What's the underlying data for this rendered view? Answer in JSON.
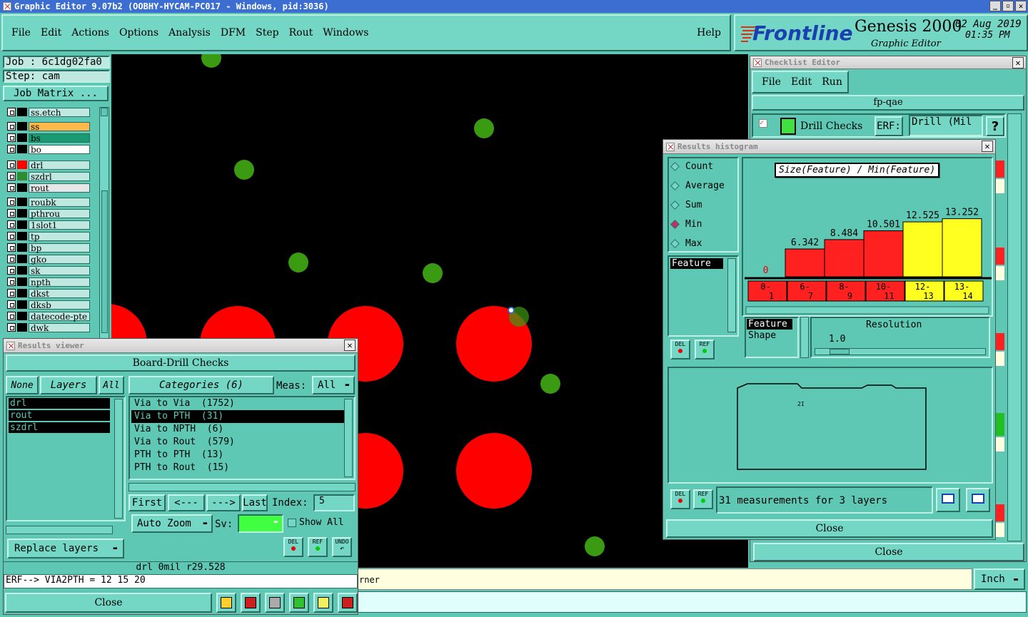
{
  "app": {
    "title": "Graphic Editor 9.07b2 (OOBHY-HYCAM-PC017 - Windows, pid:3036)"
  },
  "menu": [
    "File",
    "Edit",
    "Actions",
    "Options",
    "Analysis",
    "DFM",
    "Step",
    "Rout",
    "Windows"
  ],
  "help_label": "Help",
  "brand": {
    "logo": "Frontline",
    "product": "Genesis 2000",
    "subtitle": "Graphic Editor",
    "date": "02 Aug 2019",
    "time": "01:35 PM"
  },
  "job": {
    "job_label": "Job : 6c1dg02fa0",
    "step_label": "Step: cam",
    "matrix_button": "Job Matrix ..."
  },
  "layers": [
    {
      "name": "ss.etch",
      "color": "#000000",
      "bg": "#bfe8e0"
    },
    {
      "name": "ss",
      "color": "#000000",
      "bg": "#ffb84a"
    },
    {
      "name": "bs",
      "color": "#000000",
      "bg": "#1a9a72"
    },
    {
      "name": "bo",
      "color": "#000000",
      "bg": "#ffffff"
    },
    {
      "name": "drl",
      "color": "#ff0000",
      "bg": "#bfe8e0"
    },
    {
      "name": "szdrl",
      "color": "#2e8b2e",
      "bg": "#bfe8e0"
    },
    {
      "name": "rout",
      "color": "#000000",
      "bg": "#e6e6e6"
    },
    {
      "name": "roubk",
      "color": "#000000",
      "bg": "#bfe8e0"
    },
    {
      "name": "pthrou",
      "color": "#000000",
      "bg": "#bfe8e0"
    },
    {
      "name": "1slot1",
      "color": "#000000",
      "bg": "#bfe8e0"
    },
    {
      "name": "tp",
      "color": "#000000",
      "bg": "#bfe8e0"
    },
    {
      "name": "bp",
      "color": "#000000",
      "bg": "#bfe8e0"
    },
    {
      "name": "gko",
      "color": "#000000",
      "bg": "#bfe8e0"
    },
    {
      "name": "sk",
      "color": "#000000",
      "bg": "#bfe8e0"
    },
    {
      "name": "npth",
      "color": "#000000",
      "bg": "#bfe8e0"
    },
    {
      "name": "dkst",
      "color": "#000000",
      "bg": "#bfe8e0"
    },
    {
      "name": "dksb",
      "color": "#000000",
      "bg": "#bfe8e0"
    },
    {
      "name": "datecode-pte",
      "color": "#000000",
      "bg": "#bfe8e0"
    },
    {
      "name": "dwk",
      "color": "#000000",
      "bg": "#bfe8e0"
    }
  ],
  "results_viewer": {
    "title": "Results viewer",
    "header": "Board-Drill Checks",
    "none_btn": "None",
    "layers_btn": "Layers",
    "all_btn": "All",
    "layer_list": [
      "drl",
      "rout",
      "szdrl"
    ],
    "categories_btn": "Categories (6)",
    "meas_label": "Meas:",
    "meas_value": "All",
    "categories": [
      "Via to Via  (1752)",
      "Via to PTH  (31)",
      "Via to NPTH  (6)",
      "Via to Rout  (579)",
      "PTH to PTH  (13)",
      "PTH to Rout  (15)"
    ],
    "first_btn": "First",
    "prev_btn": "<---",
    "next_btn": "--->",
    "last_btn": "Last",
    "index_label": "Index:",
    "index_value": "5",
    "autozoom_btn": "Auto Zoom",
    "sv_label": "Sv:",
    "show_all_label": "Show All",
    "replace_btn": "Replace layers",
    "del_label": "DEL",
    "ref_label": "REF",
    "undo_label": "UNDO",
    "status1": "drl  0mil   r29.528",
    "status2": "ERF--> VIA2PTH = 12 15 20",
    "close_btn": "Close"
  },
  "checklist": {
    "title": "Checklist Editor",
    "menu": [
      "File",
      "Edit",
      "Run"
    ],
    "name": "fp-qae",
    "check_label": "Drill Checks",
    "erf_label": "ERF:",
    "erf_value": "Drill (Mil",
    "help": "?",
    "close_btn": "Close"
  },
  "histogram": {
    "title": "Results histogram",
    "options": [
      "Count",
      "Average",
      "Sum",
      "Min",
      "Max"
    ],
    "selected_option": "Min",
    "chart_title": "Size(Feature) / Min(Feature)",
    "list_item": "Feature",
    "feature_label": "Feature",
    "shape_label": "Shape",
    "resolution_label": "Resolution",
    "resolution_value": "1.0",
    "del_label": "DEL",
    "ref_label": "REF",
    "summary": "31 measurements for 3 layers",
    "close_btn": "Close",
    "preview_mark": "2I"
  },
  "chart_data": {
    "type": "bar",
    "title": "Size(Feature) / Min(Feature)",
    "categories": [
      "0-1",
      "6-7",
      "8-9",
      "10-11",
      "12-13",
      "13-14"
    ],
    "category_top": [
      "0-",
      "6-",
      "8-",
      "10-",
      "12-",
      "13-"
    ],
    "category_bottom": [
      "1",
      "7",
      "9",
      "11",
      "13",
      "14"
    ],
    "values": [
      0,
      6.342,
      8.484,
      10.501,
      12.525,
      13.252
    ],
    "labels": [
      "0",
      "6.342",
      "8.484",
      "10.501",
      "12.525",
      "13.252"
    ],
    "colors": [
      "#ff2020",
      "#ff2020",
      "#ff2020",
      "#ff2020",
      "#ffff20",
      "#ffff20"
    ],
    "ylim": [
      0,
      14
    ]
  },
  "bottom": {
    "prompt_text": "rner",
    "units": "Inch"
  },
  "colors": {
    "panel": "#5ec8b4",
    "pad_red": "#ff0000",
    "via_green": "#3a9a12"
  }
}
